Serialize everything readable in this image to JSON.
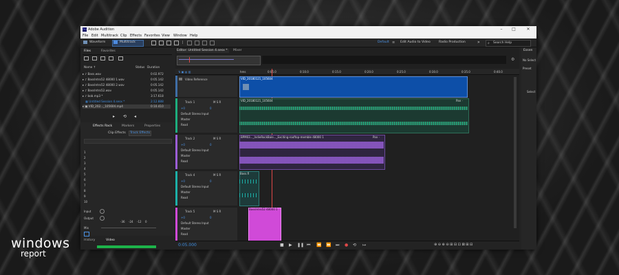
{
  "window": {
    "app_title": "Adobe Audition",
    "app_icon_label": "Au",
    "controls": [
      "–",
      "□",
      "✕"
    ]
  },
  "menu": [
    "File",
    "Edit",
    "Multitrack",
    "Clip",
    "Effects",
    "Favorites",
    "View",
    "Window",
    "Help"
  ],
  "toolbar": {
    "waveform": "Waveform",
    "multitrack": "Multitrack",
    "workspaces": [
      "Default",
      "Edit Audio to Video",
      "Radio Production"
    ],
    "search_placeholder": "Search Help"
  },
  "files_panel": {
    "tabs": [
      "Files",
      "Favorites"
    ],
    "headers": [
      "Name ↑",
      "Status",
      "Duration"
    ],
    "items": [
      {
        "name": "Bass.wav",
        "duration": "0:02.972"
      },
      {
        "name": "BassIntro52 48000 1.wav",
        "duration": "0:05.142"
      },
      {
        "name": "BassIntro52 48000 2.wav",
        "duration": "0:05.142"
      },
      {
        "name": "BassIntro52.wav",
        "duration": "0:05.142"
      },
      {
        "name": "bob.mp3 *",
        "duration": "3:17.618"
      },
      {
        "name": "Untitled Session 4.sesx *",
        "duration": "2:12.888"
      },
      {
        "name": "VID_202..._105604.mp4",
        "duration": "0:10.410"
      }
    ]
  },
  "effects_panel": {
    "tabs": [
      "Effects Rack",
      "Markers",
      "Properties"
    ],
    "subtabs": [
      "Clip Effects",
      "Track Effects"
    ],
    "slots": [
      "1",
      "2",
      "3",
      "4",
      "5",
      "6",
      "7",
      "8",
      "9",
      "10"
    ],
    "labels": [
      "Input",
      "Output",
      "Mix"
    ],
    "meter_ticks": [
      "dB",
      "-36",
      "-24",
      "-12",
      "0",
      "-12",
      "-24",
      "-36",
      "0"
    ]
  },
  "history_panel": {
    "tabs": [
      "History",
      "Video"
    ]
  },
  "editor": {
    "tabs": [
      "Editor: Untitled Session 4.sesx *",
      "Mixer"
    ],
    "ruler_unit": "hms",
    "ruler_ticks": [
      "0:05.0",
      "0:10.0",
      "0:15.0",
      "0:20.0",
      "0:25.0",
      "0:30.0",
      "0:35.0",
      "0:40.0"
    ],
    "time_display": "0:05.000",
    "video_track": {
      "name": "Video Reference",
      "clip": "VID_20180121_105604"
    },
    "tracks": [
      {
        "name": "Track 1",
        "volume": "+0",
        "pan": "0",
        "input": "Default Stereo Input",
        "output": "Master",
        "mode": "Read",
        "clip": "VID_20180121_105604",
        "clip_tag": "Pan ·",
        "color": "#1dae7e"
      },
      {
        "name": "Track 2",
        "volume": "+0",
        "pan": "0",
        "input": "Default Stereo Input",
        "output": "Master",
        "mode": "Read",
        "clip": "BPM03..._IndieRockBale..._Exciting-rooftop-memble 48000 1",
        "clip_tag": "Pan ·",
        "color": "#9b5ed6"
      },
      {
        "name": "Track 4",
        "volume": "+0",
        "pan": "0",
        "input": "Default Stereo Input",
        "output": "Master",
        "mode": "Read",
        "clip": "Bass.fl",
        "clip_tag": "",
        "color": "#1cb0a8"
      },
      {
        "name": "Track 5",
        "volume": "+0",
        "pan": "0",
        "input": "Default Stereo Input",
        "output": "Master",
        "mode": "Read",
        "clip": "BassIntro52 48000 1",
        "clip_tag": "",
        "color": "#d04ad8"
      }
    ],
    "transport": [
      "stop",
      "play",
      "pause",
      "go-start",
      "rewind",
      "fast-forward",
      "go-end",
      "record",
      "loop",
      "skip"
    ]
  },
  "right_panel": {
    "title": "Essen",
    "lines": [
      "No Select",
      "Preset",
      "Select"
    ]
  },
  "brand": {
    "line1": "windows",
    "line2": "report"
  },
  "colors": {
    "accent_blue": "#2a6ad1",
    "video_clip": "#0d4fa8",
    "time_display": "#3e8de0",
    "playhead": "#e04848",
    "meter_green": "#1db34a"
  }
}
